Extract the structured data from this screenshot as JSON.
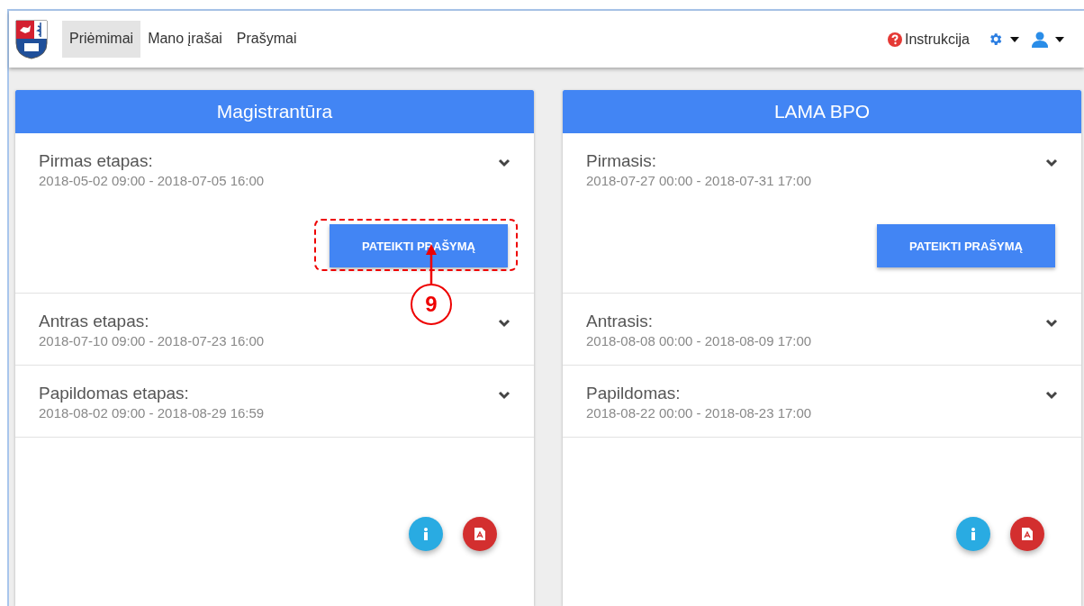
{
  "nav": {
    "items": [
      {
        "label": "Priėmimai",
        "selected": true
      },
      {
        "label": "Mano įrašai",
        "selected": false
      },
      {
        "label": "Prašymai",
        "selected": false
      }
    ],
    "help": "Instrukcija"
  },
  "cards": [
    {
      "title": "Magistrantūra",
      "stages": [
        {
          "name": "Pirmas etapas:",
          "dates": "2018-05-02 09:00 - 2018-07-05 16:00",
          "button": "PATEIKTI PRAŠYMĄ",
          "annotation": "9"
        },
        {
          "name": "Antras etapas:",
          "dates": "2018-07-10 09:00 - 2018-07-23 16:00"
        },
        {
          "name": "Papildomas etapas:",
          "dates": "2018-08-02 09:00 - 2018-08-29 16:59"
        }
      ]
    },
    {
      "title": "LAMA BPO",
      "stages": [
        {
          "name": "Pirmasis:",
          "dates": "2018-07-27 00:00 - 2018-07-31 17:00",
          "button": "PATEIKTI PRAŠYMĄ"
        },
        {
          "name": "Antrasis:",
          "dates": "2018-08-08 00:00 - 2018-08-09 17:00"
        },
        {
          "name": "Papildomas:",
          "dates": "2018-08-22 00:00 - 2018-08-23 17:00"
        }
      ]
    }
  ]
}
